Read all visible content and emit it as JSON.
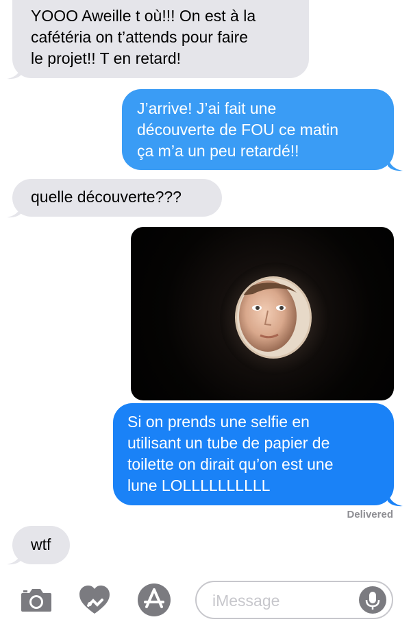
{
  "messages": {
    "m1": {
      "lines": [
        "YOOO Aweille t où!!! On est à la",
        "cafétéria on t’attends pour faire",
        "le projet!! T en retard!"
      ]
    },
    "m2": {
      "lines": [
        "J’arrive! J’ai fait une",
        "découverte de FOU ce matin",
        "ça m’a un peu retardé!!"
      ]
    },
    "m3": {
      "lines": [
        "quelle découverte???"
      ]
    },
    "m5": {
      "lines": [
        "Si on prends une selfie en",
        "utilisant un tube de papier de",
        "toilette on dirait qu’on est une",
        "lune LOLLLLLLLLLL"
      ]
    },
    "m6": {
      "lines": [
        "wtf"
      ]
    }
  },
  "status": {
    "delivered": "Delivered"
  },
  "composer": {
    "placeholder": "iMessage"
  },
  "icons": {
    "camera": "camera-icon",
    "digital_touch": "heart-icon",
    "apps": "app-store-icon",
    "mic": "microphone-icon"
  },
  "colors": {
    "incoming": "#e5e5ea",
    "outgoing": "#3a9cf5",
    "outgoing_latest": "#1a82f7",
    "icon_gray": "#7b7b80"
  }
}
